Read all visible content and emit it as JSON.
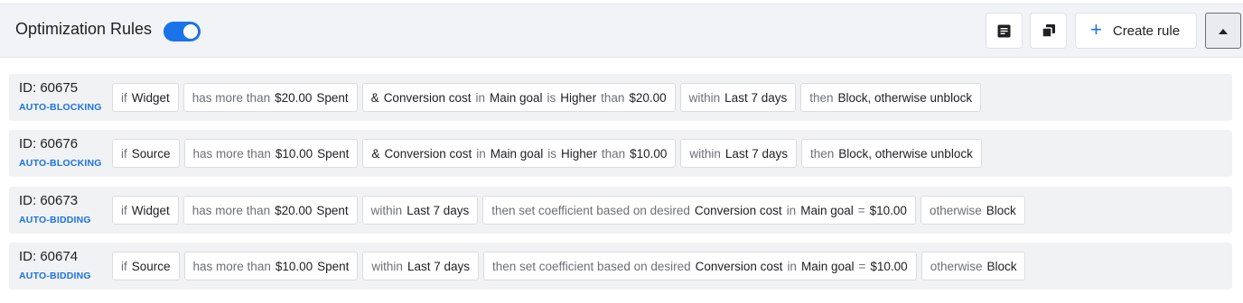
{
  "header": {
    "title": "Optimization Rules",
    "toggle_on": true,
    "create_label": "Create rule",
    "icons": [
      "notes-icon",
      "copy-icon",
      "plus-icon",
      "caret-up-icon"
    ]
  },
  "colors": {
    "accent": "#1a73e8",
    "header_bg": "#f1f3f6",
    "row_bg": "#f1f2f4"
  },
  "rules": [
    {
      "id": "ID: 60675",
      "type": "AUTO-BLOCKING",
      "chips": [
        [
          "if",
          "Widget"
        ],
        [
          "has more than",
          "$20.00",
          "Spent"
        ],
        [
          "&",
          "Conversion cost",
          "in",
          "Main goal",
          "is",
          "Higher",
          "than",
          "$20.00"
        ],
        [
          "within",
          "Last 7 days"
        ],
        [
          "then",
          "Block, otherwise unblock"
        ]
      ]
    },
    {
      "id": "ID: 60676",
      "type": "AUTO-BLOCKING",
      "chips": [
        [
          "if",
          "Source"
        ],
        [
          "has more than",
          "$10.00",
          "Spent"
        ],
        [
          "&",
          "Conversion cost",
          "in",
          "Main goal",
          "is",
          "Higher",
          "than",
          "$10.00"
        ],
        [
          "within",
          "Last 7 days"
        ],
        [
          "then",
          "Block, otherwise unblock"
        ]
      ]
    },
    {
      "id": "ID: 60673",
      "type": "AUTO-BIDDING",
      "chips": [
        [
          "if",
          "Widget"
        ],
        [
          "has more than",
          "$20.00",
          "Spent"
        ],
        [
          "within",
          "Last 7 days"
        ],
        [
          "then set coefficient based on desired",
          "Conversion cost",
          "in",
          "Main goal",
          "=",
          "$10.00"
        ],
        [
          "otherwise",
          "Block"
        ]
      ]
    },
    {
      "id": "ID: 60674",
      "type": "AUTO-BIDDING",
      "chips": [
        [
          "if",
          "Source"
        ],
        [
          "has more than",
          "$10.00",
          "Spent"
        ],
        [
          "within",
          "Last 7 days"
        ],
        [
          "then set coefficient based on desired",
          "Conversion cost",
          "in",
          "Main goal",
          "=",
          "$10.00"
        ],
        [
          "otherwise",
          "Block"
        ]
      ]
    }
  ]
}
